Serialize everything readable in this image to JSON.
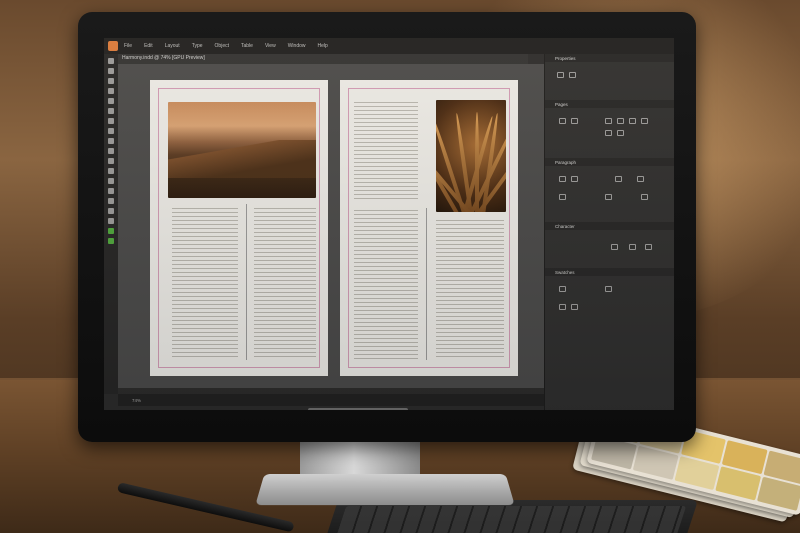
{
  "menu": [
    "File",
    "Edit",
    "Layout",
    "Type",
    "Object",
    "Table",
    "View",
    "Window",
    "Help"
  ],
  "doc_tab": "Harmony.indd @ 74% [GPU Preview]",
  "panels": {
    "properties": "Properties",
    "pages": "Pages",
    "paragraph": "Paragraph",
    "character": "Character",
    "swatches": "Swatches"
  },
  "status": "74%",
  "colors": {
    "accent": "#d9793b",
    "ui_dark": "#2c2c2c",
    "page_bg": "#ecebe7",
    "swatch_chips": [
      "#c9b98a",
      "#d8c79a",
      "#e4c36a",
      "#d9b25a",
      "#c7ad74",
      "#bdb6a6",
      "#cfc6b4",
      "#e1d09a",
      "#d8bf6e",
      "#c4b07a"
    ]
  }
}
